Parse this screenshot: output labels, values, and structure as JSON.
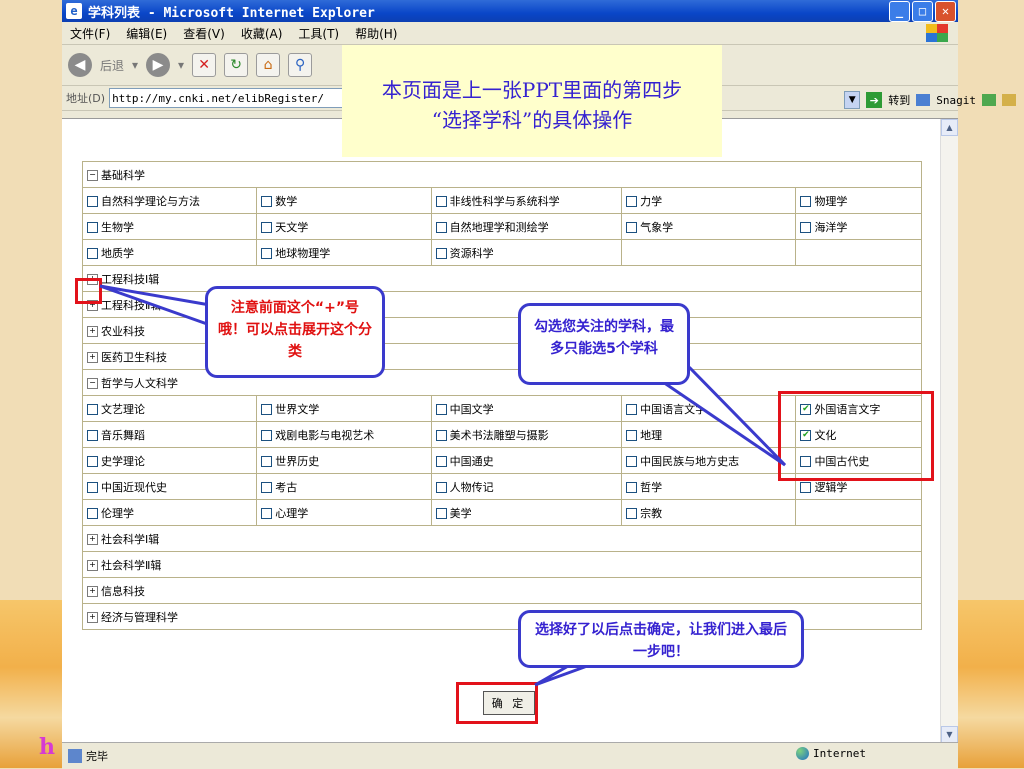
{
  "window": {
    "title": "学科列表 - Microsoft Internet Explorer"
  },
  "menubar": [
    "文件(F)",
    "编辑(E)",
    "查看(V)",
    "收藏(A)",
    "工具(T)",
    "帮助(H)"
  ],
  "toolbar": {
    "back_label": "后退"
  },
  "address": {
    "label": "地址(D)",
    "url": "http://my.cnki.net/elibRegister/",
    "goto_label": "转到",
    "snagit_label": "Snagit"
  },
  "categories": [
    {
      "label": "基础科学",
      "expander": "−",
      "rows": [
        [
          "自然科学理论与方法",
          "数学",
          "非线性科学与系统科学",
          "力学",
          "物理学"
        ],
        [
          "生物学",
          "天文学",
          "自然地理学和测绘学",
          "气象学",
          "海洋学"
        ],
        [
          "地质学",
          "地球物理学",
          "资源科学",
          "",
          ""
        ]
      ]
    },
    {
      "label": "工程科技Ⅰ辑",
      "expander": "+",
      "rows": []
    },
    {
      "label": "工程科技Ⅱ辑",
      "expander": "+",
      "rows": []
    },
    {
      "label": "农业科技",
      "expander": "+",
      "rows": []
    },
    {
      "label": "医药卫生科技",
      "expander": "+",
      "rows": []
    },
    {
      "label": "哲学与人文科学",
      "expander": "−",
      "rows": [
        [
          "文艺理论",
          "世界文学",
          "中国文学",
          "中国语言文字",
          "外国语言文字"
        ],
        [
          "音乐舞蹈",
          "戏剧电影与电视艺术",
          "美术书法雕塑与摄影",
          "地理",
          "文化"
        ],
        [
          "史学理论",
          "世界历史",
          "中国通史",
          "中国民族与地方史志",
          "中国古代史"
        ],
        [
          "中国近现代史",
          "考古",
          "人物传记",
          "哲学",
          "逻辑学"
        ],
        [
          "伦理学",
          "心理学",
          "美学",
          "宗教",
          ""
        ]
      ]
    },
    {
      "label": "社会科学Ⅰ辑",
      "expander": "+",
      "rows": []
    },
    {
      "label": "社会科学Ⅱ辑",
      "expander": "+",
      "rows": []
    },
    {
      "label": "信息科技",
      "expander": "+",
      "rows": []
    },
    {
      "label": "经济与管理科学",
      "expander": "+",
      "rows": []
    }
  ],
  "checked": [
    "外国语言文字",
    "文化"
  ],
  "confirm_label": "确 定",
  "status": {
    "text": "完毕",
    "zone": "Internet"
  },
  "notes": {
    "top_line1": "本页面是上一张PPT里面的第四步",
    "top_line2": "“选择学科”的具体操作",
    "expand_hint": "注意前面这个“+”号哦！可以点击展开这个分类",
    "select_hint": "勾选您关注的学科，最多只能选5个学科",
    "confirm_hint": "选择好了以后点击确定，让我们进入最后一步吧！"
  },
  "h_mark": "h",
  "colors": {
    "title_blue": "#0a46c8",
    "annotation_red": "#e2121a",
    "callout_border": "#3a3acc",
    "note_bg": "#ffffcc"
  }
}
